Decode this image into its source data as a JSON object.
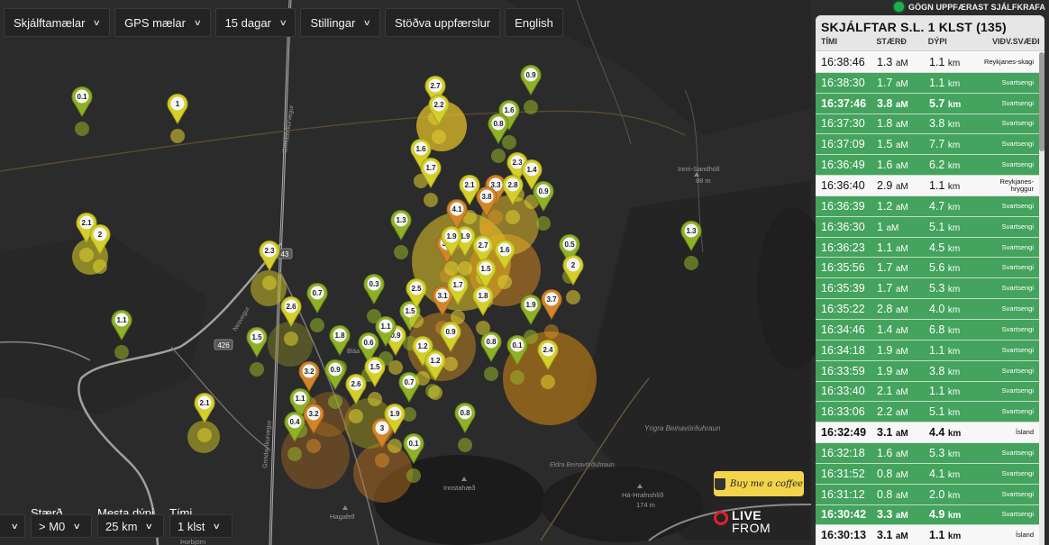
{
  "status": {
    "text": "GÖGN UPPFÆRAST SJÁLFKRAFA",
    "color": "#1bb04b"
  },
  "toolbar": {
    "items": [
      {
        "label": "Skjálftamælar",
        "dropdown": true
      },
      {
        "label": "GPS mælar",
        "dropdown": true
      },
      {
        "label": "15 dagar",
        "dropdown": true
      },
      {
        "label": "Stillingar",
        "dropdown": true
      },
      {
        "label": "Stöðva uppfærslur",
        "dropdown": false
      },
      {
        "label": "English",
        "dropdown": false
      }
    ]
  },
  "panel": {
    "title": "SKJÁLFTAR S.L. 1 KLST (135)",
    "columns": {
      "time": "TÍMI",
      "size": "STÆRÐ",
      "depth": "DÝPI",
      "location": "VIÐV.SVÆÐI"
    },
    "rows": [
      {
        "time": "16:38:46",
        "size": "1.3",
        "unit": "aM",
        "depth": "1.1",
        "depth_unit": "km",
        "loc": "Reykjanes-skagi",
        "style": "white",
        "bold": false
      },
      {
        "time": "16:38:30",
        "size": "1.7",
        "unit": "aM",
        "depth": "1.1",
        "depth_unit": "km",
        "loc": "Svartsengi",
        "style": "green",
        "bold": false
      },
      {
        "time": "16:37:46",
        "size": "3.8",
        "unit": "aM",
        "depth": "5.7",
        "depth_unit": "km",
        "loc": "Svartsengi",
        "style": "green",
        "bold": true
      },
      {
        "time": "16:37:30",
        "size": "1.8",
        "unit": "aM",
        "depth": "3.8",
        "depth_unit": "km",
        "loc": "Svartsengi",
        "style": "green",
        "bold": false
      },
      {
        "time": "16:37:09",
        "size": "1.5",
        "unit": "aM",
        "depth": "7.7",
        "depth_unit": "km",
        "loc": "Svartsengi",
        "style": "green",
        "bold": false
      },
      {
        "time": "16:36:49",
        "size": "1.6",
        "unit": "aM",
        "depth": "6.2",
        "depth_unit": "km",
        "loc": "Svartsengi",
        "style": "green",
        "bold": false
      },
      {
        "time": "16:36:40",
        "size": "2.9",
        "unit": "aM",
        "depth": "1.1",
        "depth_unit": "km",
        "loc": "Reykjanes-hryggur",
        "style": "white",
        "bold": false
      },
      {
        "time": "16:36:39",
        "size": "1.2",
        "unit": "aM",
        "depth": "4.7",
        "depth_unit": "km",
        "loc": "Svartsengi",
        "style": "green",
        "bold": false
      },
      {
        "time": "16:36:30",
        "size": "1",
        "unit": "aM",
        "depth": "5.1",
        "depth_unit": "km",
        "loc": "Svartsengi",
        "style": "green",
        "bold": false
      },
      {
        "time": "16:36:23",
        "size": "1.1",
        "unit": "aM",
        "depth": "4.5",
        "depth_unit": "km",
        "loc": "Svartsengi",
        "style": "green",
        "bold": false
      },
      {
        "time": "16:35:56",
        "size": "1.7",
        "unit": "aM",
        "depth": "5.6",
        "depth_unit": "km",
        "loc": "Svartsengi",
        "style": "green",
        "bold": false
      },
      {
        "time": "16:35:39",
        "size": "1.7",
        "unit": "aM",
        "depth": "5.3",
        "depth_unit": "km",
        "loc": "Svartsengi",
        "style": "green",
        "bold": false
      },
      {
        "time": "16:35:22",
        "size": "2.8",
        "unit": "aM",
        "depth": "4.0",
        "depth_unit": "km",
        "loc": "Svartsengi",
        "style": "green",
        "bold": false
      },
      {
        "time": "16:34:46",
        "size": "1.4",
        "unit": "aM",
        "depth": "6.8",
        "depth_unit": "km",
        "loc": "Svartsengi",
        "style": "green",
        "bold": false
      },
      {
        "time": "16:34:18",
        "size": "1.9",
        "unit": "aM",
        "depth": "1.1",
        "depth_unit": "km",
        "loc": "Svartsengi",
        "style": "green",
        "bold": false
      },
      {
        "time": "16:33:59",
        "size": "1.9",
        "unit": "aM",
        "depth": "3.8",
        "depth_unit": "km",
        "loc": "Svartsengi",
        "style": "green",
        "bold": false
      },
      {
        "time": "16:33:40",
        "size": "2.1",
        "unit": "aM",
        "depth": "1.1",
        "depth_unit": "km",
        "loc": "Svartsengi",
        "style": "green",
        "bold": false
      },
      {
        "time": "16:33:06",
        "size": "2.2",
        "unit": "aM",
        "depth": "5.1",
        "depth_unit": "km",
        "loc": "Svartsengi",
        "style": "green",
        "bold": false
      },
      {
        "time": "16:32:49",
        "size": "3.1",
        "unit": "aM",
        "depth": "4.4",
        "depth_unit": "km",
        "loc": "Ísland",
        "style": "white",
        "bold": true
      },
      {
        "time": "16:32:18",
        "size": "1.6",
        "unit": "aM",
        "depth": "5.3",
        "depth_unit": "km",
        "loc": "Svartsengi",
        "style": "green",
        "bold": false
      },
      {
        "time": "16:31:52",
        "size": "0.8",
        "unit": "aM",
        "depth": "4.1",
        "depth_unit": "km",
        "loc": "Svartsengi",
        "style": "green",
        "bold": false
      },
      {
        "time": "16:31:12",
        "size": "0.8",
        "unit": "aM",
        "depth": "2.0",
        "depth_unit": "km",
        "loc": "Svartsengi",
        "style": "green",
        "bold": false
      },
      {
        "time": "16:30:42",
        "size": "3.3",
        "unit": "aM",
        "depth": "4.9",
        "depth_unit": "km",
        "loc": "Svartsengi",
        "style": "green",
        "bold": true
      },
      {
        "time": "16:30:13",
        "size": "3.1",
        "unit": "aM",
        "depth": "1.1",
        "depth_unit": "km",
        "loc": "Ísland",
        "style": "white",
        "bold": true
      }
    ]
  },
  "filters": {
    "size_label": "Stærð",
    "size_value": "> M0",
    "depth_label": "Mesta dýpi",
    "depth_value": "25 km",
    "time_label": "Tími",
    "time_value": "1 klst"
  },
  "coffee": {
    "label": "Buy me a coffee"
  },
  "logo": {
    "line1": "LIVE",
    "line2": "FROM",
    "line3": "ICELAND"
  },
  "map_labels": {
    "innri_sandholl": "Innri-Sandhóll",
    "innri_sandholl_elev": "88 m",
    "yngra": "Yngra Beinavörðuhraun",
    "eldra": "Eldra Beinavörðuhraun",
    "innstahaed": "Innstahæð",
    "ha_hrafnshlid": "Há-Hrafnshlíð",
    "ha_hrafnshlid_elev": "174 m",
    "hagafell": "Hagafell",
    "thorbjorn": "Þorbjörn",
    "road_43": "43",
    "road_426": "426",
    "grindavikurvegur": "Grindavíkurvegur",
    "nesvegur": "Nesvegur",
    "blaa": "Bláa"
  },
  "quakes": [
    {
      "mag": "0.1",
      "color": "green"
    },
    {
      "mag": "1",
      "color": "yellow"
    },
    {
      "mag": "2.7",
      "color": "yellow"
    },
    {
      "mag": "2.2",
      "color": "yellow"
    },
    {
      "mag": "0.9",
      "color": "green"
    },
    {
      "mag": "1.6",
      "color": "green"
    },
    {
      "mag": "0.8",
      "color": "green"
    },
    {
      "mag": "1.6",
      "color": "yellow"
    },
    {
      "mag": "1.7",
      "color": "yellow"
    },
    {
      "mag": "2.3",
      "color": "yellow"
    },
    {
      "mag": "1.4",
      "color": "yellow"
    },
    {
      "mag": "2.1",
      "color": "yellow"
    },
    {
      "mag": "3.3",
      "color": "orange"
    },
    {
      "mag": "2.8",
      "color": "yellow"
    },
    {
      "mag": "3.8",
      "color": "orange"
    },
    {
      "mag": "0.9",
      "color": "green"
    },
    {
      "mag": "4.1",
      "color": "orange"
    },
    {
      "mag": "2.1",
      "color": "yellow"
    },
    {
      "mag": "2",
      "color": "yellow"
    },
    {
      "mag": "1.3",
      "color": "green"
    },
    {
      "mag": "0.5",
      "color": "green"
    },
    {
      "mag": "2",
      "color": "yellow"
    },
    {
      "mag": "2.3",
      "color": "yellow"
    },
    {
      "mag": "0.7",
      "color": "green"
    },
    {
      "mag": "0.3",
      "color": "green"
    },
    {
      "mag": "2.6",
      "color": "yellow"
    },
    {
      "mag": "3.4",
      "color": "orange"
    },
    {
      "mag": "1.9",
      "color": "yellow"
    },
    {
      "mag": "2.7",
      "color": "yellow"
    },
    {
      "mag": "1.6",
      "color": "yellow"
    },
    {
      "mag": "1.5",
      "color": "yellow"
    },
    {
      "mag": "3.1",
      "color": "orange"
    },
    {
      "mag": "1.8",
      "color": "yellow"
    },
    {
      "mag": "3.7",
      "color": "orange"
    },
    {
      "mag": "1.9",
      "color": "green"
    },
    {
      "mag": "1.1",
      "color": "green"
    },
    {
      "mag": "1.5",
      "color": "green"
    },
    {
      "mag": "1.8",
      "color": "green"
    },
    {
      "mag": "0.6",
      "color": "green"
    },
    {
      "mag": "0.9",
      "color": "yellow"
    },
    {
      "mag": "0.8",
      "color": "green"
    },
    {
      "mag": "0.1",
      "color": "green"
    },
    {
      "mag": "2.4",
      "color": "yellow"
    },
    {
      "mag": "3.2",
      "color": "orange"
    },
    {
      "mag": "0.9",
      "color": "green"
    },
    {
      "mag": "2.6",
      "color": "yellow"
    },
    {
      "mag": "1.5",
      "color": "yellow"
    },
    {
      "mag": "0.7",
      "color": "green"
    },
    {
      "mag": "1.2",
      "color": "green"
    },
    {
      "mag": "1.1",
      "color": "green"
    },
    {
      "mag": "3.2",
      "color": "orange"
    },
    {
      "mag": "0.4",
      "color": "green"
    },
    {
      "mag": "3",
      "color": "orange"
    },
    {
      "mag": "1.9",
      "color": "yellow"
    },
    {
      "mag": "0.8",
      "color": "green"
    },
    {
      "mag": "0.1",
      "color": "green"
    },
    {
      "mag": "2.1",
      "color": "yellow"
    },
    {
      "mag": "1.5",
      "color": "green"
    },
    {
      "mag": "1.1",
      "color": "green"
    },
    {
      "mag": "1.3",
      "color": "green"
    },
    {
      "mag": "2.5",
      "color": "yellow"
    },
    {
      "mag": "1.2",
      "color": "yellow"
    },
    {
      "mag": "1.9",
      "color": "yellow"
    },
    {
      "mag": "0.9",
      "color": "yellow"
    },
    {
      "mag": "1.2",
      "color": "yellow"
    },
    {
      "mag": "1.7",
      "color": "yellow"
    }
  ]
}
